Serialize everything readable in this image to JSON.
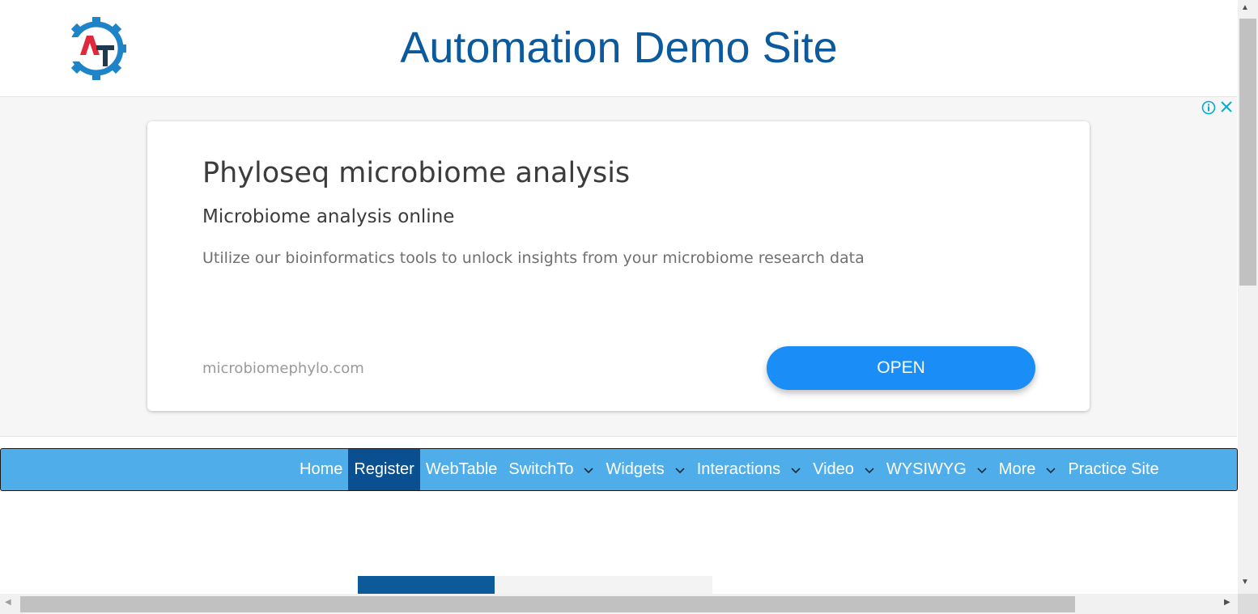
{
  "header": {
    "site_title": "Automation Demo Site",
    "logo_icon": "gear-at-logo",
    "brand_color": "#0c5a9e"
  },
  "ad": {
    "title": "Phyloseq microbiome analysis",
    "subtitle": "Microbiome analysis online",
    "description": "Utilize our bioinformatics tools to unlock insights from your microbiome research data",
    "domain": "microbiomephylo.com",
    "open_label": "OPEN",
    "info_icon": "info-icon",
    "close_icon": "close-icon",
    "button_color": "#1a8ef6"
  },
  "nav": {
    "items": [
      {
        "label": "Home",
        "dropdown": false,
        "active": false
      },
      {
        "label": "Register",
        "dropdown": false,
        "active": true
      },
      {
        "label": "WebTable",
        "dropdown": false,
        "active": false
      },
      {
        "label": "SwitchTo",
        "dropdown": true,
        "active": false
      },
      {
        "label": "Widgets",
        "dropdown": true,
        "active": false
      },
      {
        "label": "Interactions",
        "dropdown": true,
        "active": false
      },
      {
        "label": "Video",
        "dropdown": true,
        "active": false
      },
      {
        "label": "WYSIWYG",
        "dropdown": true,
        "active": false
      },
      {
        "label": "More",
        "dropdown": true,
        "active": false
      },
      {
        "label": "Practice Site",
        "dropdown": false,
        "active": false
      }
    ],
    "bar_color": "#4faeea",
    "active_color": "#0a4f8f"
  }
}
